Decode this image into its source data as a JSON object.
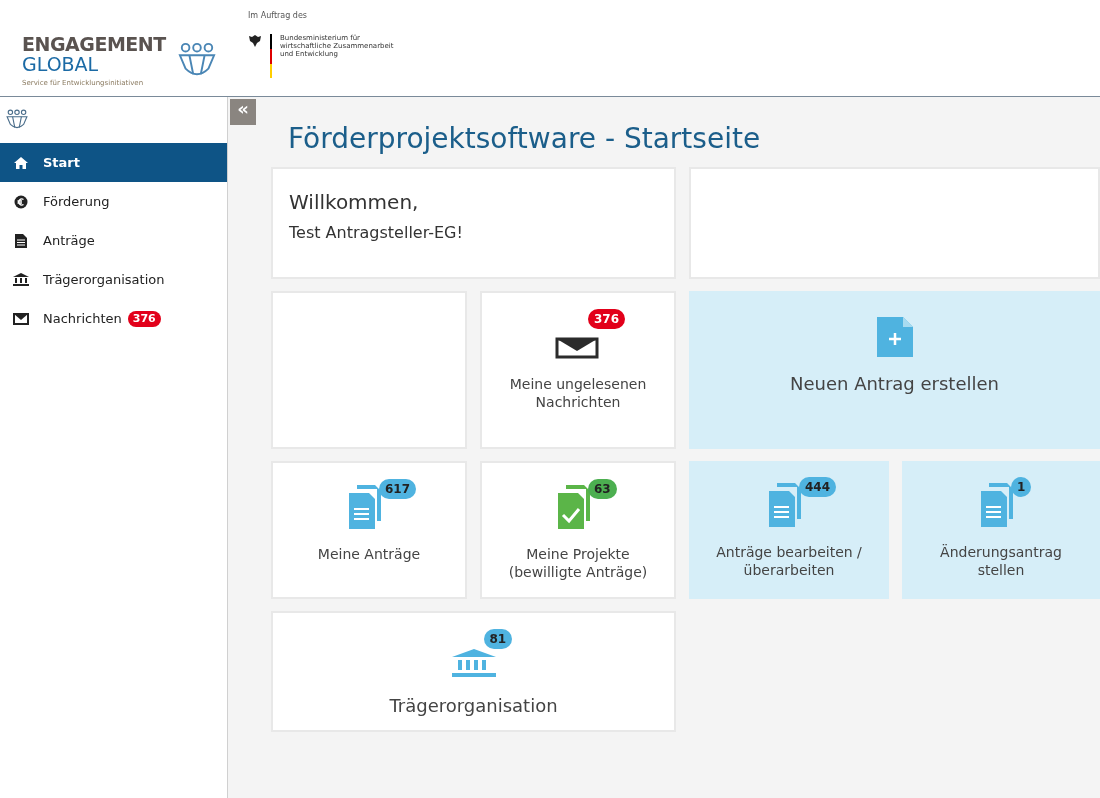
{
  "header": {
    "logo": {
      "line1": "ENGAGEMENT",
      "line2": "GLOBAL",
      "tagline": "Service für Entwicklungsinitiativen"
    },
    "commission_label": "Im Auftrag des",
    "ministry": [
      "Bundesministerium für",
      "wirtschaftliche Zusammenarbeit",
      "und Entwicklung"
    ]
  },
  "sidebar": {
    "collapse_button": "«",
    "items": [
      {
        "label": "Start",
        "selected": true
      },
      {
        "label": "Förderung",
        "selected": false
      },
      {
        "label": "Anträge",
        "selected": false
      },
      {
        "label": "Trägerorganisation",
        "selected": false
      },
      {
        "label": "Nachrichten",
        "badge": "376",
        "selected": false
      }
    ]
  },
  "page_title": "Förderprojektsoftware - Startseite",
  "tiles": [
    {
      "kind": "welcome",
      "greeting": "Willkommen,",
      "user": "Test Antragsteller-EG!"
    },
    {
      "kind": "empty"
    },
    {
      "kind": "empty"
    },
    {
      "kind": "tile",
      "badge": "376",
      "label": "Meine ungelesenen Nachrichten"
    },
    {
      "kind": "highlight",
      "label": "Neuen Antrag erstellen"
    },
    {
      "kind": "tile",
      "badge": "617",
      "label": "Meine Anträge"
    },
    {
      "kind": "tile",
      "badge": "63",
      "label": "Meine Projekte (bewilligte Anträge)"
    },
    {
      "kind": "highlight",
      "badge": "444",
      "label": "Anträge bearbeiten / überarbeiten"
    },
    {
      "kind": "highlight",
      "badge": "1",
      "label": "Änderungsantrag stellen"
    },
    {
      "kind": "tile",
      "badge": "81",
      "label": "Trägerorganisation"
    }
  ]
}
